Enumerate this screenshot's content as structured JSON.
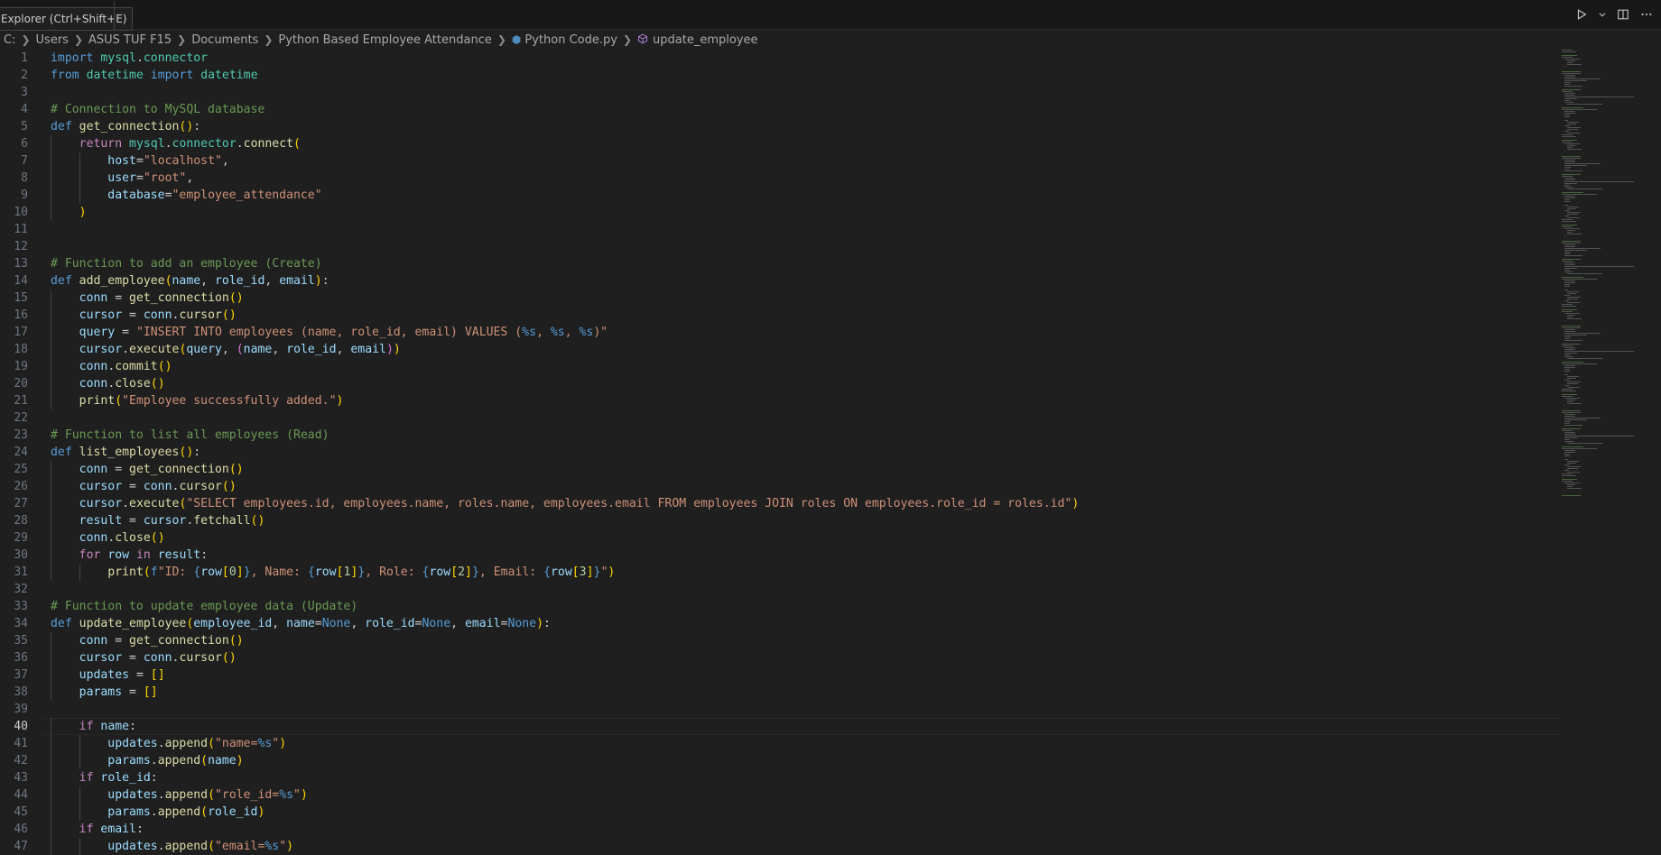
{
  "tooltip": "Explorer (Ctrl+Shift+E)",
  "breadcrumb": [
    "C:",
    "Users",
    "ASUS TUF F15",
    "Documents",
    "Python Based Employee Attendance",
    "Python Code.py",
    "update_employee"
  ],
  "current_line": 40,
  "icons": {
    "run": "play-icon",
    "run_dropdown": "chevron-down-icon",
    "split": "split-editor-icon",
    "more": "ellipsis-icon",
    "file": "python-file-icon",
    "symbol": "method-symbol-icon"
  },
  "code_lines": [
    {
      "n": 1,
      "t": "import mysql.connector"
    },
    {
      "n": 2,
      "t": "from datetime import datetime"
    },
    {
      "n": 3,
      "t": ""
    },
    {
      "n": 4,
      "t": "# Connection to MySQL database"
    },
    {
      "n": 5,
      "t": "def get_connection():"
    },
    {
      "n": 6,
      "t": "    return mysql.connector.connect("
    },
    {
      "n": 7,
      "t": "        host=\"localhost\","
    },
    {
      "n": 8,
      "t": "        user=\"root\","
    },
    {
      "n": 9,
      "t": "        database=\"employee_attendance\""
    },
    {
      "n": 10,
      "t": "    )"
    },
    {
      "n": 11,
      "t": ""
    },
    {
      "n": 12,
      "t": ""
    },
    {
      "n": 13,
      "t": "# Function to add an employee (Create)"
    },
    {
      "n": 14,
      "t": "def add_employee(name, role_id, email):"
    },
    {
      "n": 15,
      "t": "    conn = get_connection()"
    },
    {
      "n": 16,
      "t": "    cursor = conn.cursor()"
    },
    {
      "n": 17,
      "t": "    query = \"INSERT INTO employees (name, role_id, email) VALUES (%s, %s, %s)\""
    },
    {
      "n": 18,
      "t": "    cursor.execute(query, (name, role_id, email))"
    },
    {
      "n": 19,
      "t": "    conn.commit()"
    },
    {
      "n": 20,
      "t": "    conn.close()"
    },
    {
      "n": 21,
      "t": "    print(\"Employee successfully added.\")"
    },
    {
      "n": 22,
      "t": ""
    },
    {
      "n": 23,
      "t": "# Function to list all employees (Read)"
    },
    {
      "n": 24,
      "t": "def list_employees():"
    },
    {
      "n": 25,
      "t": "    conn = get_connection()"
    },
    {
      "n": 26,
      "t": "    cursor = conn.cursor()"
    },
    {
      "n": 27,
      "t": "    cursor.execute(\"SELECT employees.id, employees.name, roles.name, employees.email FROM employees JOIN roles ON employees.role_id = roles.id\")"
    },
    {
      "n": 28,
      "t": "    result = cursor.fetchall()"
    },
    {
      "n": 29,
      "t": "    conn.close()"
    },
    {
      "n": 30,
      "t": "    for row in result:"
    },
    {
      "n": 31,
      "t": "        print(f\"ID: {row[0]}, Name: {row[1]}, Role: {row[2]}, Email: {row[3]}\")"
    },
    {
      "n": 32,
      "t": ""
    },
    {
      "n": 33,
      "t": "# Function to update employee data (Update)"
    },
    {
      "n": 34,
      "t": "def update_employee(employee_id, name=None, role_id=None, email=None):"
    },
    {
      "n": 35,
      "t": "    conn = get_connection()"
    },
    {
      "n": 36,
      "t": "    cursor = conn.cursor()"
    },
    {
      "n": 37,
      "t": "    updates = []"
    },
    {
      "n": 38,
      "t": "    params = []"
    },
    {
      "n": 39,
      "t": ""
    },
    {
      "n": 40,
      "t": "    if name:"
    },
    {
      "n": 41,
      "t": "        updates.append(\"name=%s\")"
    },
    {
      "n": 42,
      "t": "        params.append(name)"
    },
    {
      "n": 43,
      "t": "    if role_id:"
    },
    {
      "n": 44,
      "t": "        updates.append(\"role_id=%s\")"
    },
    {
      "n": 45,
      "t": "        params.append(role_id)"
    },
    {
      "n": 46,
      "t": "    if email:"
    },
    {
      "n": 47,
      "t": "        updates.append(\"email=%s\")"
    }
  ]
}
